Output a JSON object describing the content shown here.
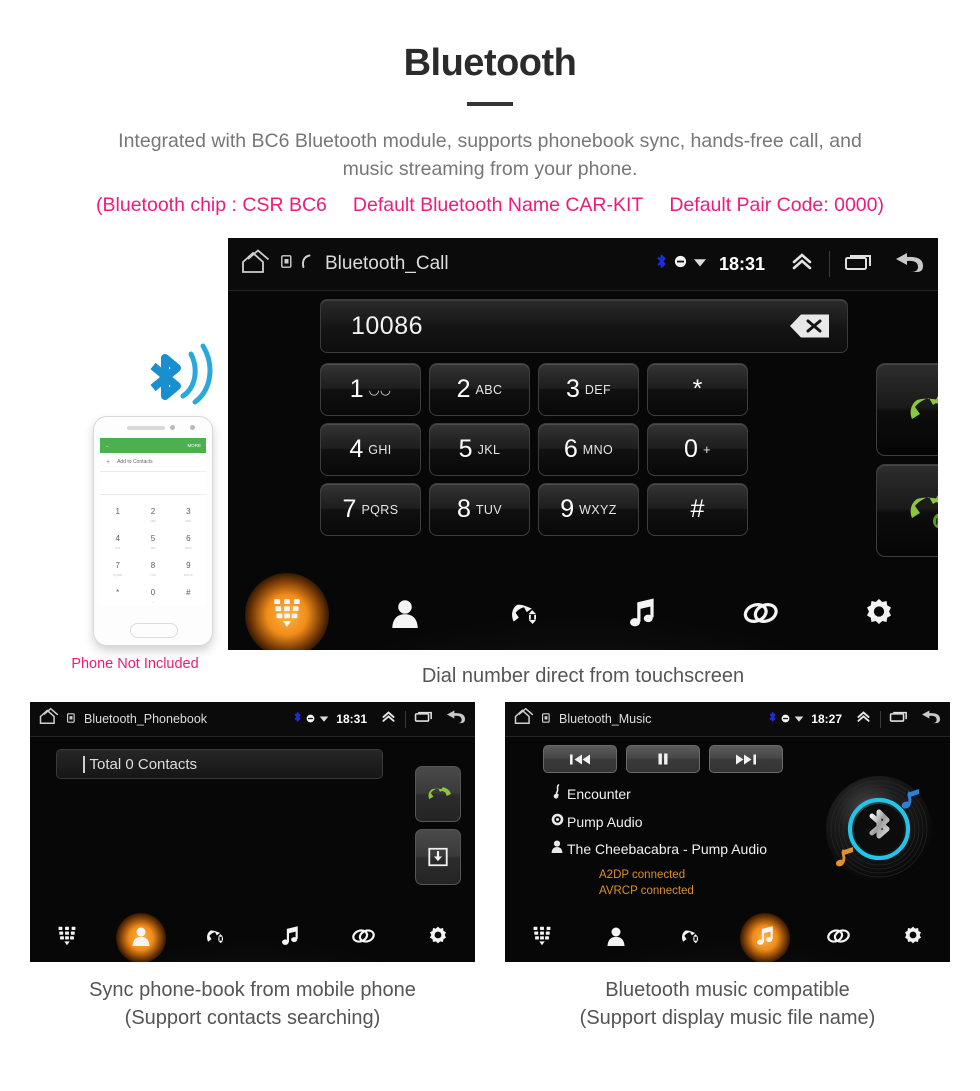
{
  "header": {
    "title": "Bluetooth",
    "description_line1": "Integrated with BC6 Bluetooth module, supports phonebook sync, hands-free call, and",
    "description_line2": "music streaming from your phone.",
    "spec_chip": "(Bluetooth chip : CSR BC6",
    "spec_name": "Default Bluetooth Name CAR-KIT",
    "spec_paircode": "Default Pair Code: 0000)",
    "accent_color": "#ec1c7d",
    "text_color": "#777777"
  },
  "phone_illustration": {
    "app_more_label": "MORE",
    "add_contact_label": "Add to Contacts",
    "add_contact_plus": "+",
    "back_arrow": "←",
    "keys": [
      {
        "digit": "1",
        "letters": ""
      },
      {
        "digit": "2",
        "letters": "ABC"
      },
      {
        "digit": "3",
        "letters": "DEF"
      },
      {
        "digit": "4",
        "letters": "GHI"
      },
      {
        "digit": "5",
        "letters": "JKL"
      },
      {
        "digit": "6",
        "letters": "MNO"
      },
      {
        "digit": "7",
        "letters": "PQRS"
      },
      {
        "digit": "8",
        "letters": "TUV"
      },
      {
        "digit": "9",
        "letters": "WXYZ"
      },
      {
        "digit": "*",
        "letters": ""
      },
      {
        "digit": "0",
        "letters": "+"
      },
      {
        "digit": "#",
        "letters": ""
      }
    ],
    "caption": "Phone Not Included",
    "bluetooth_icon": "bluetooth-waves-icon",
    "bluetooth_color": "#29a8e0"
  },
  "main_screen": {
    "hud": {
      "home_icon": "home-icon",
      "sd_icon": "sdcard-icon",
      "phone_icon": "phone-icon",
      "title": "Bluetooth_Call",
      "bluetooth_icon": "bluetooth-icon",
      "mute_icon": "mute-icon",
      "signal_icon": "signal-icon",
      "time": "18:31",
      "expand_icon": "chevron-up-icon",
      "recents_icon": "recents-icon",
      "back_icon": "back-arrow-icon"
    },
    "number_input": {
      "value": "10086",
      "backspace_icon": "backspace-icon"
    },
    "keypad": [
      {
        "digit": "1",
        "letters": "◡◡"
      },
      {
        "digit": "2",
        "letters": "ABC"
      },
      {
        "digit": "3",
        "letters": "DEF"
      },
      {
        "digit": "*",
        "letters": ""
      },
      {
        "digit": "4",
        "letters": "GHI"
      },
      {
        "digit": "5",
        "letters": "JKL"
      },
      {
        "digit": "6",
        "letters": "MNO"
      },
      {
        "digit": "0",
        "letters": "+"
      },
      {
        "digit": "7",
        "letters": "PQRS"
      },
      {
        "digit": "8",
        "letters": "TUV"
      },
      {
        "digit": "9",
        "letters": "WXYZ"
      },
      {
        "digit": "#",
        "letters": ""
      }
    ],
    "call_button": {
      "icon": "call-handset-icon",
      "color": "#8cc63f"
    },
    "redial_button": {
      "icon": "redial-handset-icon",
      "badge": "RE",
      "color": "#8cc63f"
    },
    "nav": [
      {
        "name": "dialpad",
        "icon": "dialpad-icon",
        "active": true
      },
      {
        "name": "contacts",
        "icon": "contact-person-icon",
        "active": false
      },
      {
        "name": "call-history",
        "icon": "call-history-icon",
        "active": false
      },
      {
        "name": "music",
        "icon": "music-note-icon",
        "active": false
      },
      {
        "name": "pair",
        "icon": "link-chain-icon",
        "active": false
      },
      {
        "name": "settings",
        "icon": "gear-icon",
        "active": false
      }
    ],
    "caption": "Dial number direct from touchscreen",
    "active_highlight_color": "#f08c1a"
  },
  "phonebook_screen": {
    "hud": {
      "home_icon": "home-icon",
      "sd_icon": "sdcard-icon",
      "title": "Bluetooth_Phonebook",
      "bluetooth_icon": "bluetooth-icon",
      "mute_icon": "mute-icon",
      "signal_icon": "signal-icon",
      "time": "18:31",
      "expand_icon": "chevron-up-icon",
      "recents_icon": "recents-icon",
      "back_icon": "back-arrow-icon"
    },
    "search": {
      "value": "Total 0 Contacts"
    },
    "call_button_icon": "call-handset-icon",
    "download_button_icon": "download-contacts-icon",
    "nav": [
      {
        "name": "dialpad",
        "icon": "dialpad-icon",
        "active": false
      },
      {
        "name": "contacts",
        "icon": "contact-person-icon",
        "active": true
      },
      {
        "name": "call-history",
        "icon": "call-history-icon",
        "active": false
      },
      {
        "name": "music",
        "icon": "music-note-icon",
        "active": false
      },
      {
        "name": "pair",
        "icon": "link-chain-icon",
        "active": false
      },
      {
        "name": "settings",
        "icon": "gear-icon",
        "active": false
      }
    ],
    "caption_line1": "Sync phone-book from mobile phone",
    "caption_line2": "(Support contacts searching)"
  },
  "music_screen": {
    "hud": {
      "home_icon": "home-icon",
      "sd_icon": "sdcard-icon",
      "title": "Bluetooth_Music",
      "bluetooth_icon": "bluetooth-icon",
      "mute_icon": "mute-icon",
      "signal_icon": "signal-icon",
      "time": "18:27",
      "expand_icon": "chevron-up-icon",
      "recents_icon": "recents-icon",
      "back_icon": "back-arrow-icon"
    },
    "transport": [
      {
        "name": "previous",
        "icon": "skip-previous-icon"
      },
      {
        "name": "pause",
        "icon": "pause-icon"
      },
      {
        "name": "next",
        "icon": "skip-next-icon"
      }
    ],
    "track": {
      "title_icon": "note-icon",
      "title": "Encounter",
      "album_icon": "disc-icon",
      "album": "Pump Audio",
      "artist_icon": "person-icon",
      "artist": "The Cheebacabra - Pump Audio"
    },
    "status": {
      "a2dp": "A2DP connected",
      "avrcp": "AVRCP connected",
      "color": "#d9902a"
    },
    "disc_icon": "vinyl-bluetooth-disc-icon",
    "nav": [
      {
        "name": "dialpad",
        "icon": "dialpad-icon",
        "active": false
      },
      {
        "name": "contacts",
        "icon": "contact-person-icon",
        "active": false
      },
      {
        "name": "call-history",
        "icon": "call-history-icon",
        "active": false
      },
      {
        "name": "music",
        "icon": "music-note-icon",
        "active": true
      },
      {
        "name": "pair",
        "icon": "link-chain-icon",
        "active": false
      },
      {
        "name": "settings",
        "icon": "gear-icon",
        "active": false
      }
    ],
    "caption_line1": "Bluetooth music compatible",
    "caption_line2": "(Support display music file name)"
  }
}
